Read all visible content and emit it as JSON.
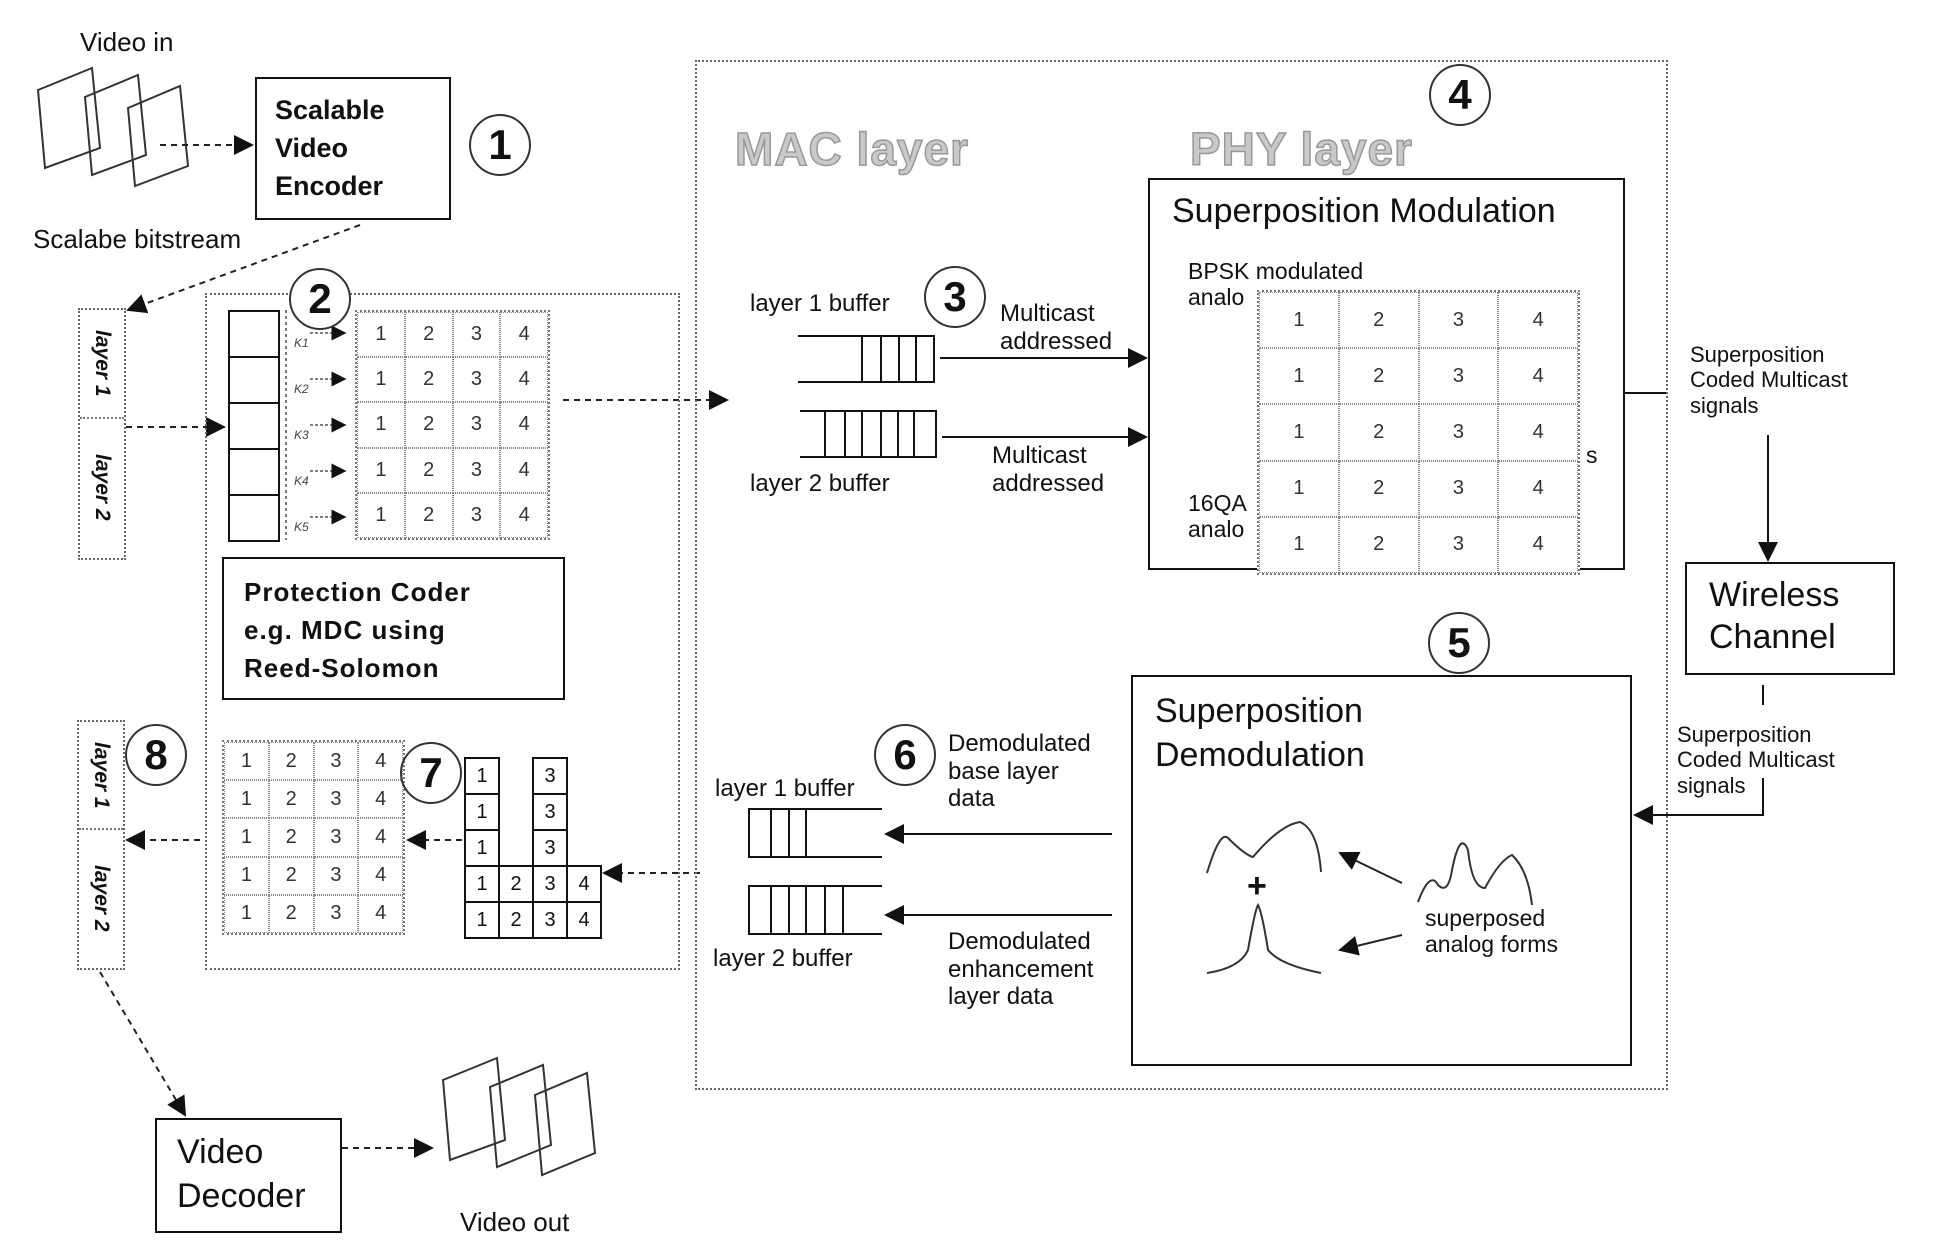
{
  "video_in": {
    "label": "Video in"
  },
  "encoder": {
    "lines": [
      "Scalable",
      "Video",
      "Encoder"
    ],
    "step": "1"
  },
  "bitstream_label": "Scalabe bitstream",
  "layers_top": {
    "layer1": "layer 1",
    "layer2": "layer 2"
  },
  "protection": {
    "step": "2",
    "row_labels": [
      "K1",
      "K2",
      "K3",
      "K4",
      "K5"
    ],
    "grid": [
      [
        "1",
        "2",
        "3",
        "4"
      ],
      [
        "1",
        "2",
        "3",
        "4"
      ],
      [
        "1",
        "2",
        "3",
        "4"
      ],
      [
        "1",
        "2",
        "3",
        "4"
      ],
      [
        "1",
        "2",
        "3",
        "4"
      ]
    ],
    "coder_lines": [
      "Protection Coder",
      "e.g. MDC using",
      "Reed-Solomon"
    ]
  },
  "mac_layer": {
    "title": "MAC layer",
    "tx_step": "3",
    "tx_layer1_buffer": "layer 1 buffer",
    "tx_layer2_buffer": "layer 2 buffer",
    "tx_arrow1": [
      "Multicast",
      "addressed"
    ],
    "tx_arrow2": [
      "Multicast",
      "addressed"
    ],
    "rx_step": "6",
    "rx_layer1_buffer": "layer 1 buffer",
    "rx_layer2_buffer": "layer 2 buffer",
    "rx_arrow1": [
      "Demodulated",
      "base layer",
      "data"
    ],
    "rx_arrow2": [
      "Demodulated",
      "enhancement",
      "layer data"
    ]
  },
  "phy_layer": {
    "title": "PHY layer",
    "step": "4",
    "modulation": {
      "title": "Superposition Modulation",
      "bpsk_lines": [
        "BPSK modulated",
        "analo"
      ],
      "qam_lines": [
        "16QA",
        "analo"
      ],
      "hidden_suffix": "s",
      "grid": [
        [
          "1",
          "2",
          "3",
          "4"
        ],
        [
          "1",
          "2",
          "3",
          "4"
        ],
        [
          "1",
          "2",
          "3",
          "4"
        ],
        [
          "1",
          "2",
          "3",
          "4"
        ],
        [
          "1",
          "2",
          "3",
          "4"
        ]
      ]
    }
  },
  "channel": {
    "tx_signal": [
      "Superposition",
      "Coded Multicast",
      "signals"
    ],
    "title_lines": [
      "Wireless",
      "Channel"
    ],
    "rx_signal": [
      "Superposition",
      "Coded Multicast",
      "signals"
    ]
  },
  "demodulation": {
    "step": "5",
    "title_lines": [
      "Superposition",
      "Demodulation"
    ],
    "plus": "+",
    "forms_label": [
      "superposed",
      "analog forms"
    ]
  },
  "receiver": {
    "step7": "7",
    "stack": [
      [
        "1",
        "",
        "3",
        ""
      ],
      [
        "1",
        "",
        "3",
        ""
      ],
      [
        "1",
        "",
        "3",
        ""
      ],
      [
        "1",
        "2",
        "3",
        "4"
      ],
      [
        "1",
        "2",
        "3",
        "4"
      ]
    ],
    "decoded_grid": [
      [
        "1",
        "2",
        "3",
        "4"
      ],
      [
        "1",
        "2",
        "3",
        "4"
      ],
      [
        "1",
        "2",
        "3",
        "4"
      ],
      [
        "1",
        "2",
        "3",
        "4"
      ],
      [
        "1",
        "2",
        "3",
        "4"
      ]
    ],
    "step8": "8",
    "layers": {
      "layer1": "layer 1",
      "layer2": "layer 2"
    }
  },
  "decoder": {
    "lines": [
      "Video",
      "Decoder"
    ]
  },
  "video_out": {
    "label": "Video out"
  }
}
